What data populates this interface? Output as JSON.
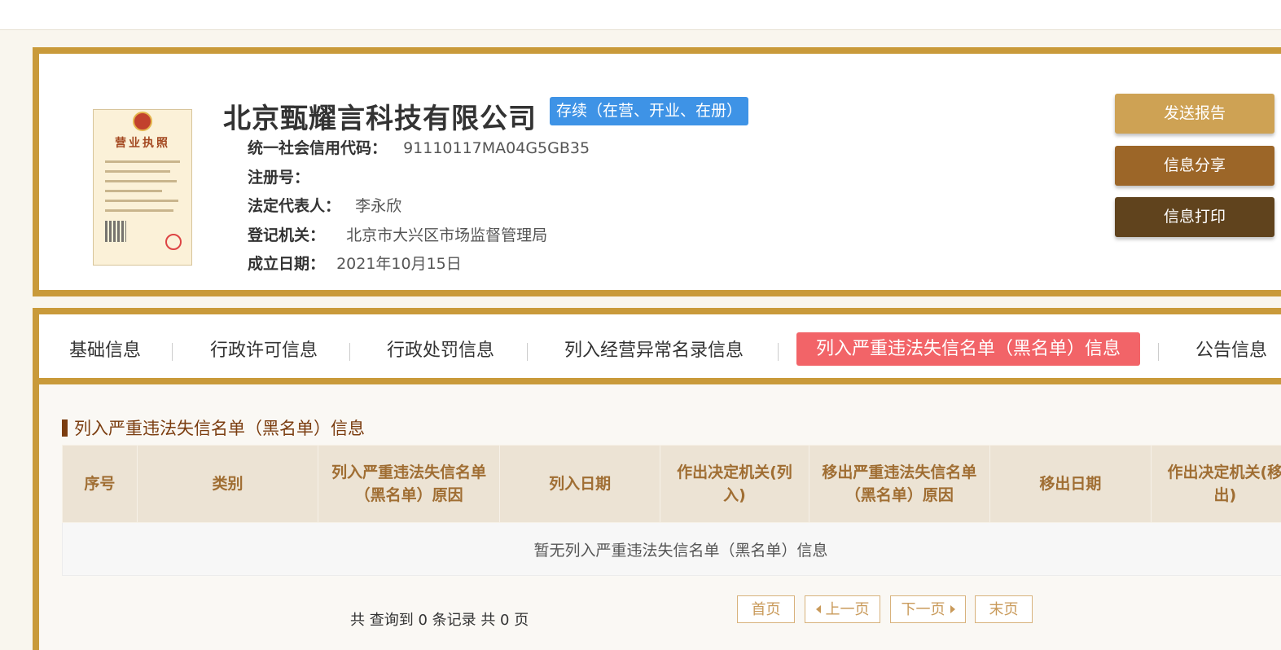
{
  "company": {
    "name": "北京甄耀言科技有限公司",
    "status": "存续（在营、开业、在册）",
    "fields": [
      {
        "label": "统一社会信用代码：",
        "value": "91110117MA04G5GB35"
      },
      {
        "label": "注册号：",
        "value": ""
      },
      {
        "label": "法定代表人：",
        "value": "李永欣"
      },
      {
        "label": "登记机关：",
        "value": "北京市大兴区市场监督管理局"
      },
      {
        "label": "成立日期：",
        "value": "2021年10月15日"
      }
    ],
    "license_title": "营业执照"
  },
  "actions": [
    {
      "label": "发送报告",
      "color": "#cea254"
    },
    {
      "label": "信息分享",
      "color": "#9c6628"
    },
    {
      "label": "信息打印",
      "color": "#60431d"
    }
  ],
  "tabs": [
    {
      "label": "基础信息"
    },
    {
      "label": "行政许可信息"
    },
    {
      "label": "行政处罚信息"
    },
    {
      "label": "列入经营异常名录信息"
    },
    {
      "label": "列入严重违法失信名单（黑名单）信息",
      "active": true
    },
    {
      "label": "公告信息"
    }
  ],
  "section": {
    "title": "列入严重违法失信名单（黑名单）信息",
    "columns": [
      "序号",
      "类别",
      "列入严重违法失信名单（黑名单）原因",
      "列入日期",
      "作出决定机关(列入)",
      "移出严重违法失信名单（黑名单）原因",
      "移出日期",
      "作出决定机关(移出)"
    ],
    "empty_text": "暂无列入严重违法失信名单（黑名单）信息"
  },
  "pagination": {
    "summary": "共 查询到 0 条记录 共 0 页",
    "first": "首页",
    "prev": "上一页",
    "next": "下一页",
    "last": "末页"
  },
  "colors": {
    "border_gold": "#c99a3a",
    "status_blue": "#3e93e6",
    "active_tab": "#f26468",
    "header_bg": "#ece3d4",
    "header_text": "#a06e33"
  }
}
